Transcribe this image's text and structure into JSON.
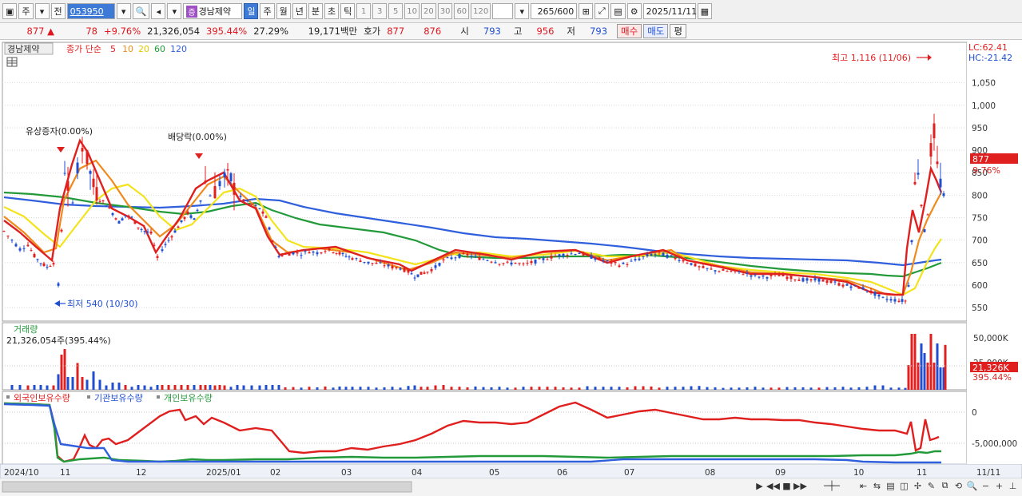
{
  "toolbar": {
    "market_type": "주",
    "prev_label": "전",
    "stock_code": "053950",
    "stock_badge": "증",
    "stock_name": "경남제약",
    "periods": [
      "일",
      "주",
      "월",
      "년",
      "분",
      "초",
      "틱"
    ],
    "active_period": "일",
    "intervals": [
      "1",
      "3",
      "5",
      "10",
      "20",
      "30",
      "60",
      "120"
    ],
    "count": "265",
    "count_max": "/600",
    "date": "2025/11/11"
  },
  "quote": {
    "price": "877",
    "arrow": "▲",
    "change": "78",
    "change_pct": "+9.76%",
    "volume": "21,326,054",
    "volume_pct": "395.44%",
    "turnover": "27.29%",
    "amount": "19,171백만",
    "hoga_label": "호가",
    "ask": "877",
    "bid": "876",
    "open_label": "시",
    "open": "793",
    "high_label": "고",
    "high": "956",
    "low_label": "저",
    "low": "793",
    "buy_label": "매수",
    "sell_label": "매도",
    "avg_label": "평"
  },
  "price_panel": {
    "stock_label": "경남제약",
    "ma_label": "종가 단순",
    "ma_periods": [
      "5",
      "10",
      "20",
      "60",
      "120"
    ],
    "ma_colors": [
      "#e01f1f",
      "#f08a1c",
      "#f3e31c",
      "#239a3a",
      "#2f5fdc"
    ],
    "lc_label": "LC:62.41",
    "hc_label": "HC:-21.42",
    "high_annotation": "최고 1,116 (11/06)",
    "low_annotation": "최저 540 (10/30)",
    "event_rights": "유상증자(0.00%)",
    "event_dividend": "배당락(0.00%)",
    "current_price": "877",
    "current_pct": "9.76%"
  },
  "volume_panel": {
    "title": "거래량",
    "value_label": "21,326,054주(395.44%)",
    "current_badge": "21,326K",
    "current_pct": "395.44%",
    "hidden_tick": "25,000K"
  },
  "holdings_panel": {
    "legend": [
      "외국인보유수량",
      "기관보유수량",
      "개인보유수량"
    ],
    "colors": [
      "#e01f1f",
      "#2f5fdc",
      "#239a3a"
    ]
  },
  "x_axis": {
    "labels": [
      "2024/10",
      "11",
      "12",
      "2025/01",
      "02",
      "03",
      "04",
      "05",
      "06",
      "07",
      "08",
      "09",
      "10",
      "11"
    ],
    "right_label": "11/11"
  },
  "chart_data": [
    {
      "type": "candlestick",
      "title": "경남제약",
      "y_ticks": [
        550,
        600,
        650,
        700,
        750,
        800,
        850,
        900,
        950,
        1000,
        1050
      ],
      "ylim": [
        520,
        1140
      ],
      "annotations": [
        {
          "text": "최고 1,116 (11/06)",
          "value": 1116
        },
        {
          "text": "최저 540 (10/30)",
          "value": 540
        }
      ],
      "close_path": [
        [
          0,
          720
        ],
        [
          10,
          700
        ],
        [
          20,
          680
        ],
        [
          30,
          690
        ],
        [
          38,
          665
        ],
        [
          46,
          650
        ],
        [
          54,
          640
        ],
        [
          62,
          650
        ],
        [
          68,
          600
        ],
        [
          72,
          720
        ],
        [
          76,
          860
        ],
        [
          80,
          820
        ],
        [
          86,
          780
        ],
        [
          92,
          870
        ],
        [
          98,
          910
        ],
        [
          104,
          880
        ],
        [
          112,
          820
        ],
        [
          120,
          790
        ],
        [
          128,
          780
        ],
        [
          136,
          760
        ],
        [
          144,
          740
        ],
        [
          152,
          755
        ],
        [
          160,
          750
        ],
        [
          168,
          730
        ],
        [
          176,
          720
        ],
        [
          184,
          715
        ],
        [
          192,
          660
        ],
        [
          198,
          680
        ],
        [
          206,
          700
        ],
        [
          214,
          720
        ],
        [
          222,
          740
        ],
        [
          230,
          760
        ],
        [
          238,
          745
        ],
        [
          246,
          790
        ],
        [
          252,
          830
        ],
        [
          258,
          800
        ],
        [
          264,
          810
        ],
        [
          270,
          830
        ],
        [
          276,
          840
        ],
        [
          284,
          835
        ],
        [
          292,
          800
        ],
        [
          300,
          790
        ],
        [
          310,
          780
        ],
        [
          320,
          770
        ],
        [
          328,
          750
        ],
        [
          336,
          700
        ],
        [
          344,
          665
        ],
        [
          352,
          668
        ],
        [
          362,
          672
        ],
        [
          372,
          670
        ],
        [
          382,
          675
        ],
        [
          392,
          672
        ],
        [
          402,
          678
        ],
        [
          412,
          676
        ],
        [
          420,
          670
        ],
        [
          428,
          665
        ],
        [
          436,
          660
        ],
        [
          446,
          655
        ],
        [
          456,
          650
        ],
        [
          466,
          648
        ],
        [
          476,
          645
        ],
        [
          486,
          640
        ],
        [
          496,
          638
        ],
        [
          506,
          630
        ],
        [
          514,
          620
        ],
        [
          522,
          625
        ],
        [
          530,
          630
        ],
        [
          540,
          640
        ],
        [
          550,
          655
        ],
        [
          560,
          660
        ],
        [
          570,
          665
        ],
        [
          580,
          668
        ],
        [
          590,
          662
        ],
        [
          600,
          658
        ],
        [
          610,
          655
        ],
        [
          620,
          650
        ],
        [
          630,
          648
        ],
        [
          640,
          650
        ],
        [
          650,
          645
        ],
        [
          660,
          650
        ],
        [
          670,
          655
        ],
        [
          680,
          660
        ],
        [
          690,
          665
        ],
        [
          700,
          668
        ],
        [
          710,
          670
        ],
        [
          720,
          672
        ],
        [
          730,
          665
        ],
        [
          740,
          660
        ],
        [
          750,
          655
        ],
        [
          760,
          650
        ],
        [
          770,
          645
        ],
        [
          780,
          648
        ],
        [
          790,
          655
        ],
        [
          800,
          662
        ],
        [
          810,
          668
        ],
        [
          820,
          670
        ],
        [
          830,
          665
        ],
        [
          840,
          660
        ],
        [
          850,
          655
        ],
        [
          860,
          648
        ],
        [
          870,
          640
        ],
        [
          880,
          636
        ],
        [
          890,
          633
        ],
        [
          900,
          632
        ],
        [
          910,
          630
        ],
        [
          920,
          628
        ],
        [
          930,
          625
        ],
        [
          940,
          620
        ],
        [
          950,
          618
        ],
        [
          960,
          620
        ],
        [
          970,
          622
        ],
        [
          980,
          618
        ],
        [
          990,
          615
        ],
        [
          1000,
          612
        ],
        [
          1010,
          610
        ],
        [
          1020,
          612
        ],
        [
          1030,
          608
        ],
        [
          1040,
          605
        ],
        [
          1050,
          600
        ],
        [
          1060,
          598
        ],
        [
          1070,
          595
        ],
        [
          1080,
          590
        ],
        [
          1090,
          580
        ],
        [
          1100,
          570
        ],
        [
          1110,
          568
        ],
        [
          1120,
          566
        ],
        [
          1128,
          565
        ],
        [
          1132,
          600
        ],
        [
          1136,
          700
        ],
        [
          1140,
          820
        ],
        [
          1144,
          860
        ],
        [
          1148,
          780
        ],
        [
          1152,
          720
        ],
        [
          1156,
          760
        ],
        [
          1160,
          900
        ],
        [
          1164,
          940
        ],
        [
          1168,
          860
        ],
        [
          1172,
          830
        ],
        [
          1176,
          800
        ],
        [
          1178,
          877
        ]
      ]
    },
    {
      "type": "bar",
      "title": "거래량",
      "y_ticks": [
        "50,000K"
      ],
      "current": 21326054
    },
    {
      "type": "line",
      "series": [
        {
          "name": "외국인보유수량"
        },
        {
          "name": "기관보유수량"
        },
        {
          "name": "개인보유수량"
        }
      ],
      "y_ticks": [
        "0",
        "-5,000,000"
      ]
    }
  ]
}
